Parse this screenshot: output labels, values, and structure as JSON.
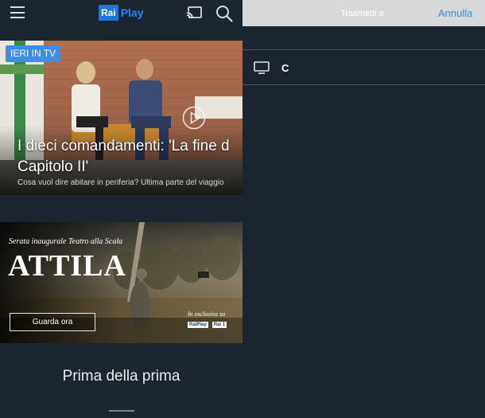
{
  "app": {
    "logo_rai": "Rai",
    "logo_play": "Play"
  },
  "icons": {
    "menu": "hamburger-menu-icon",
    "cast": "cast-icon",
    "search": "search-icon",
    "play": "play-circle-icon",
    "tv": "tv-icon"
  },
  "hero": {
    "badge": "IERI IN TV",
    "title_line1": "I dieci comandamenti: 'La fine d",
    "title_line2": "Capitolo II'",
    "subtitle": "Cosa vuol dire abitare in periferia? Ultima parte del viaggio"
  },
  "promo": {
    "kicker": "Serata inaugurale Teatro alla Scala",
    "title": "ATTILA",
    "button_label": "Guarda ora",
    "exclusive_label": "In esclusiva su",
    "logos": [
      "RaiPlay",
      "Rai 1"
    ]
  },
  "section": {
    "title": "Prima della prima"
  },
  "cast_dialog": {
    "title": "Trasmetti a",
    "cancel_label": "Annulla",
    "devices": [
      {
        "name": "C"
      }
    ]
  },
  "colors": {
    "accent": "#3d8ee6",
    "background": "#1c2631",
    "dialog_header": "#d7d8da"
  }
}
